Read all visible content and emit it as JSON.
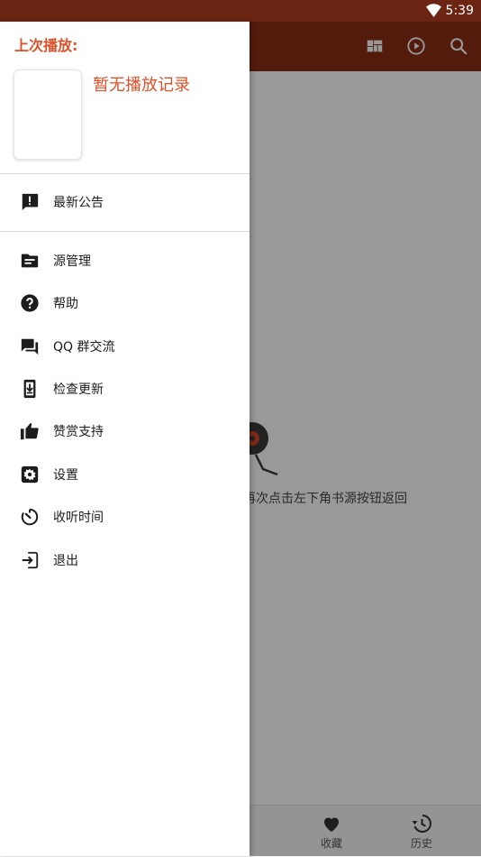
{
  "status_bar": {
    "time": "5:39",
    "wifi_icon": "wifi-icon"
  },
  "app_bar": {
    "color": "#8a2d14",
    "actions": [
      "grid-view-icon",
      "play-circle-icon",
      "search-icon"
    ]
  },
  "main": {
    "empty_hint": "主入源后可再次点击左下角书源按钮返回"
  },
  "bottom_nav": {
    "items": [
      {
        "label": "收藏",
        "icon": "heart-icon"
      },
      {
        "label": "历史",
        "icon": "history-icon"
      }
    ]
  },
  "drawer": {
    "last_played_title": "上次播放:",
    "no_record_text": "暂无播放记录",
    "accent_color": "#e0512a",
    "menu": [
      {
        "label": "最新公告",
        "icon": "announcement-icon"
      },
      {
        "label": "源管理",
        "icon": "source-folder-icon"
      },
      {
        "label": "帮助",
        "icon": "help-icon"
      },
      {
        "label": "QQ 群交流",
        "icon": "chat-forum-icon"
      },
      {
        "label": "检查更新",
        "icon": "update-download-icon"
      },
      {
        "label": "赞赏支持",
        "icon": "thumb-up-icon"
      },
      {
        "label": "设置",
        "icon": "settings-icon"
      },
      {
        "label": "收听时间",
        "icon": "timer-icon"
      },
      {
        "label": "退出",
        "icon": "exit-icon"
      }
    ]
  }
}
